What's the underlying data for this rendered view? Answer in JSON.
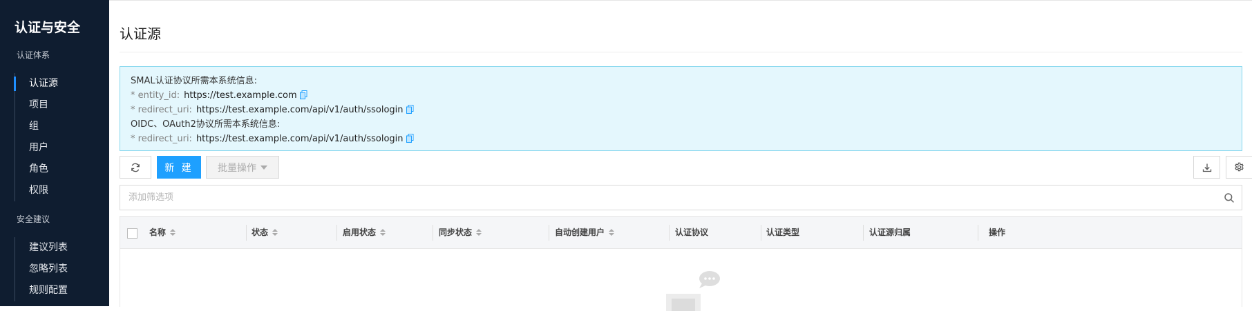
{
  "sidebar": {
    "title": "认证与安全",
    "groups": [
      {
        "title": "认证体系",
        "items": [
          "认证源",
          "项目",
          "组",
          "用户",
          "角色",
          "权限"
        ],
        "active": "认证源"
      },
      {
        "title": "安全建议",
        "items": [
          "建议列表",
          "忽略列表",
          "规则配置"
        ]
      }
    ]
  },
  "page": {
    "title": "认证源"
  },
  "info": {
    "saml_heading": "SMAL认证协议所需本系统信息:",
    "entity_id_key": "* entity_id:",
    "entity_id_value": "https://test.example.com",
    "redirect_key": "* redirect_uri:",
    "redirect_value": "https://test.example.com/api/v1/auth/ssologin",
    "oidc_heading": "OIDC、OAuth2协议所需本系统信息:",
    "oidc_redirect_key": "* redirect_uri:",
    "oidc_redirect_value": "https://test.example.com/api/v1/auth/ssologin"
  },
  "toolbar": {
    "refresh_icon": "refresh-icon",
    "new_label": "新 建",
    "batch_label": "批量操作",
    "download_icon": "download-icon",
    "settings_icon": "gear-icon"
  },
  "filter": {
    "placeholder": "添加筛选项",
    "search_icon": "search-icon"
  },
  "table": {
    "columns": [
      "名称",
      "状态",
      "启用状态",
      "同步状态",
      "自动创建用户",
      "认证协议",
      "认证类型",
      "认证源归属",
      "操作"
    ],
    "sortable": [
      true,
      true,
      true,
      true,
      true,
      false,
      false,
      false,
      false
    ],
    "rows": []
  },
  "colors": {
    "accent": "#1ea0ff",
    "sidebar_bg": "#0f1d30",
    "info_bg": "#e4f7fd"
  }
}
